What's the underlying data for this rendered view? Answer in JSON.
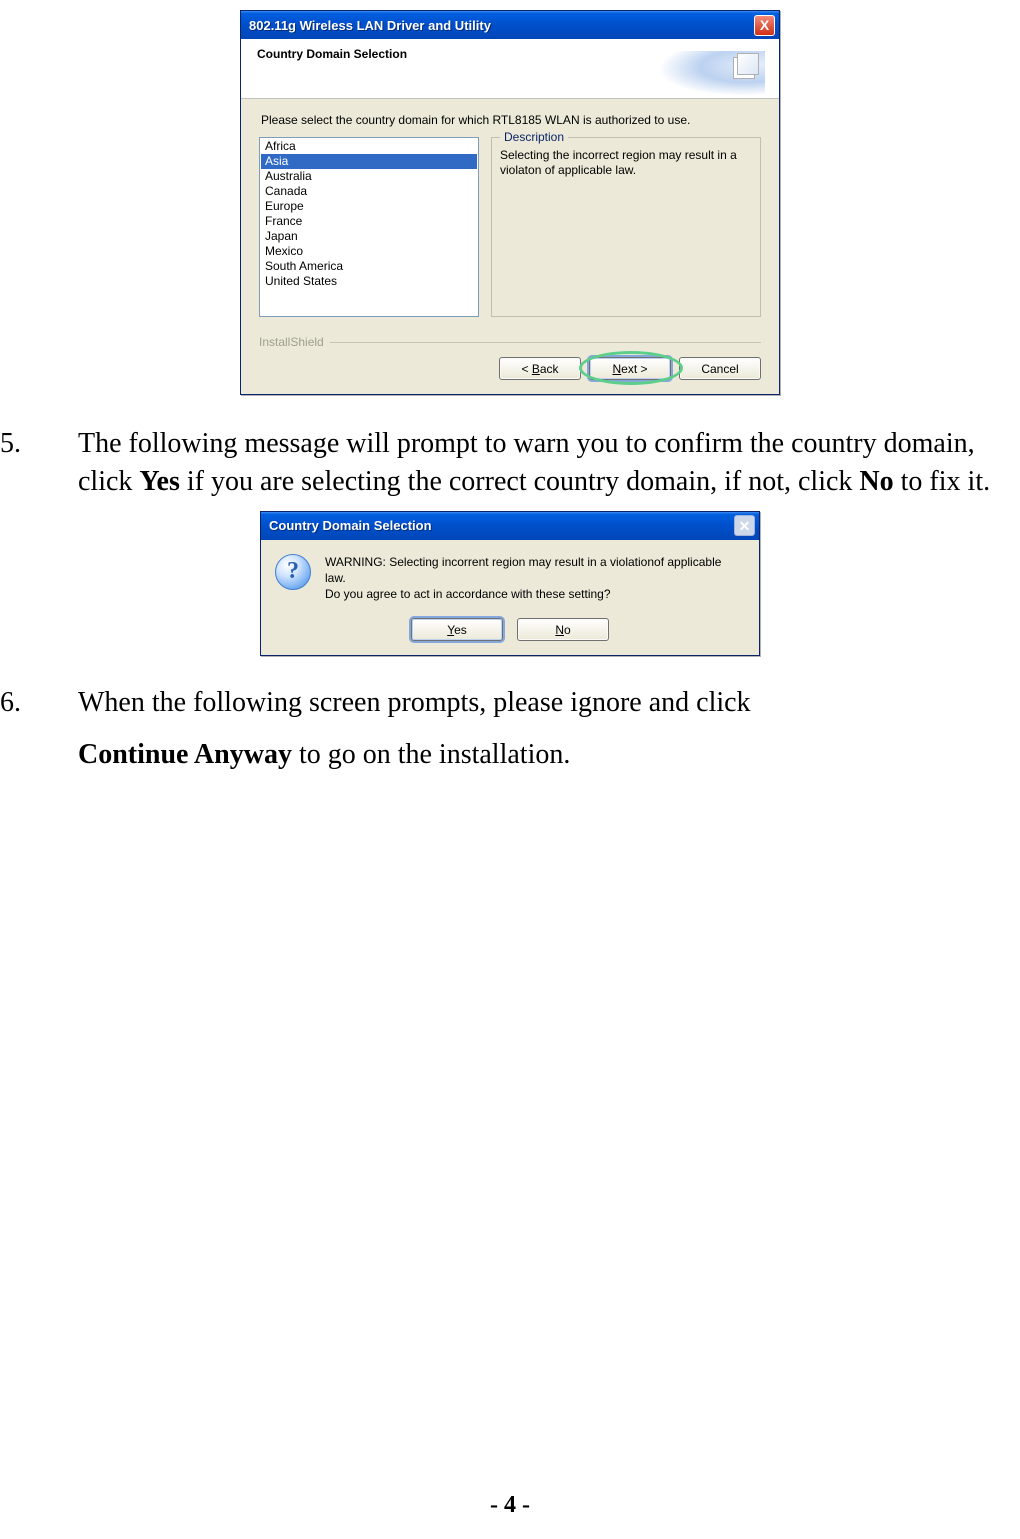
{
  "page_number": "- 4 -",
  "step5": {
    "num": "5.",
    "t1": "The following message will prompt to warn you to confirm the country domain, click ",
    "b1": "Yes",
    "t2": " if you are selecting the correct country domain, if not, click ",
    "b2": "No",
    "t3": " to fix it."
  },
  "step6": {
    "num": "6.",
    "t1": "When the following screen prompts, please ignore and click ",
    "b1": "Continue Anyway",
    "t2": " to go on the installation."
  },
  "win1": {
    "title": "802.11g Wireless LAN Driver and Utility",
    "banner_title": "Country Domain Selection",
    "prompt": "Please select the country domain for which RTL8185 WLAN is authorized to use.",
    "countries": [
      "Africa",
      "Asia",
      "Australia",
      "Canada",
      "Europe",
      "France",
      "Japan",
      "Mexico",
      "South America",
      "United States"
    ],
    "selected_index": 1,
    "desc_legend": "Description",
    "desc_text": "Selecting the incorrect region may result in a violaton of applicable law.",
    "installshield": "InstallShield",
    "btn_back": "< Back",
    "btn_next": "Next >",
    "btn_cancel": "Cancel",
    "close_x": "X"
  },
  "win2": {
    "title": "Country Domain Selection",
    "msg_l1": "WARNING: Selecting incorrent region may result in a violationof applicable law.",
    "msg_l2": "Do you agree to act in accordance with these setting?",
    "btn_yes": "Yes",
    "btn_no": "No",
    "yes_u": "Y",
    "no_u": "N",
    "q": "?"
  }
}
